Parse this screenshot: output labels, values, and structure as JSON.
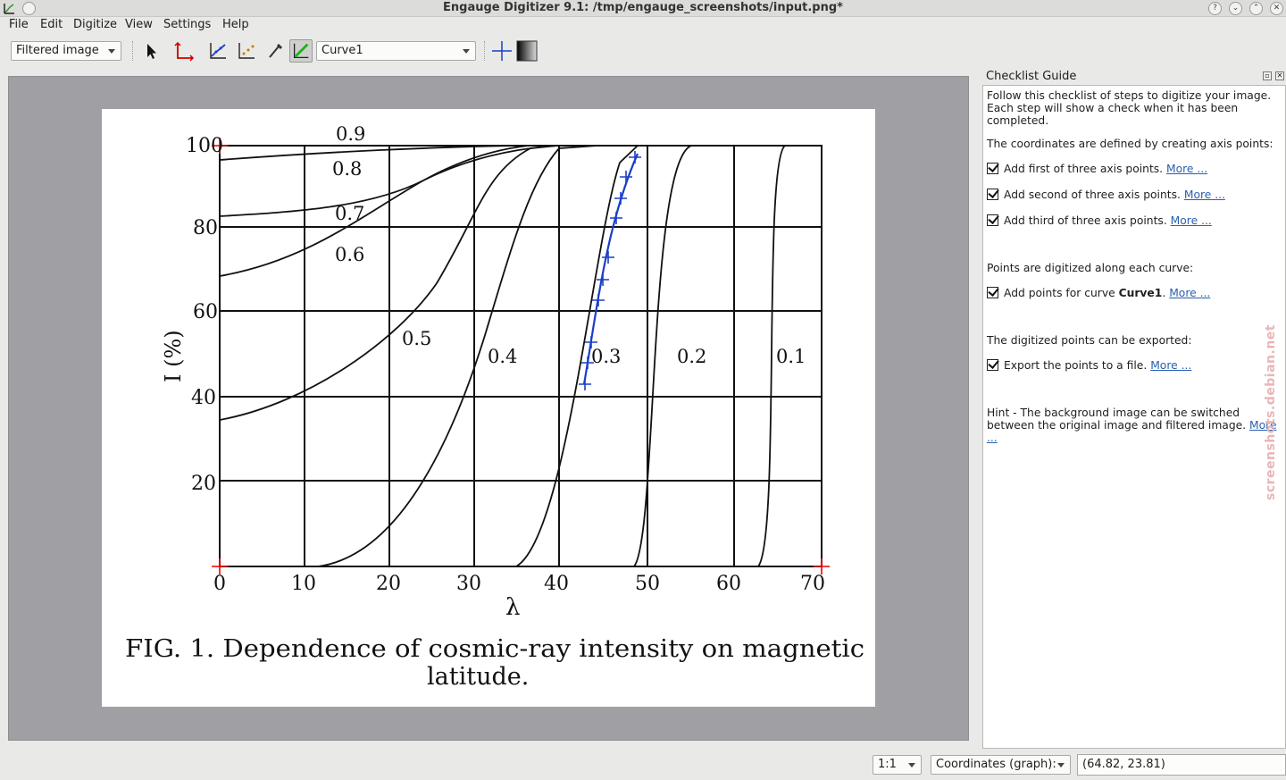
{
  "window": {
    "title": "Engauge Digitizer 9.1: /tmp/engauge_screenshots/input.png*"
  },
  "menu": [
    "File",
    "Edit",
    "Digitize",
    "View",
    "Settings",
    "Help"
  ],
  "toolbar": {
    "background_mode": "Filtered image",
    "curve": "Curve1"
  },
  "checklist": {
    "title": "Checklist Guide",
    "intro": "Follow this checklist of steps to digitize your image. Each step will show a check when it has been completed.",
    "axis_heading": "The coordinates are defined by creating axis points:",
    "steps": [
      {
        "text": "Add first of three axis points.",
        "link": "More ..."
      },
      {
        "text": "Add second of three axis points.",
        "link": "More ..."
      },
      {
        "text": "Add third of three axis points.",
        "link": "More ..."
      }
    ],
    "curve_heading": "Points are digitized along each curve:",
    "curve_step_prefix": "Add points for curve ",
    "curve_step_name": "Curve1",
    "curve_step_suffix": ".",
    "curve_step_link": "More ...",
    "export_heading": "The digitized points can be exported:",
    "export_step": "Export the points to a file.",
    "export_link": "More ...",
    "hint": "Hint - The background image can be switched between the original image and filtered image.",
    "hint_link": "More ..."
  },
  "figure": {
    "y_label": "I (%)",
    "x_label": "λ",
    "y_ticks": [
      "100",
      "80",
      "60",
      "40",
      "20"
    ],
    "x_ticks": [
      "0",
      "10",
      "20",
      "30",
      "40",
      "50",
      "60",
      "70"
    ],
    "curve_labels": [
      "0.9",
      "0.8",
      "0.7",
      "0.6",
      "0.5",
      "0.4",
      "0.3",
      "0.2",
      "0.1"
    ],
    "caption_line1": "FIG. 1. Dependence of cosmic-ray intensity on magnetic",
    "caption_line2": "latitude."
  },
  "status": {
    "zoom": "1:1",
    "coord_mode": "Coordinates (graph):",
    "coord_value": "(64.82, 23.81)"
  },
  "watermark": "screenshots.debian.net"
}
